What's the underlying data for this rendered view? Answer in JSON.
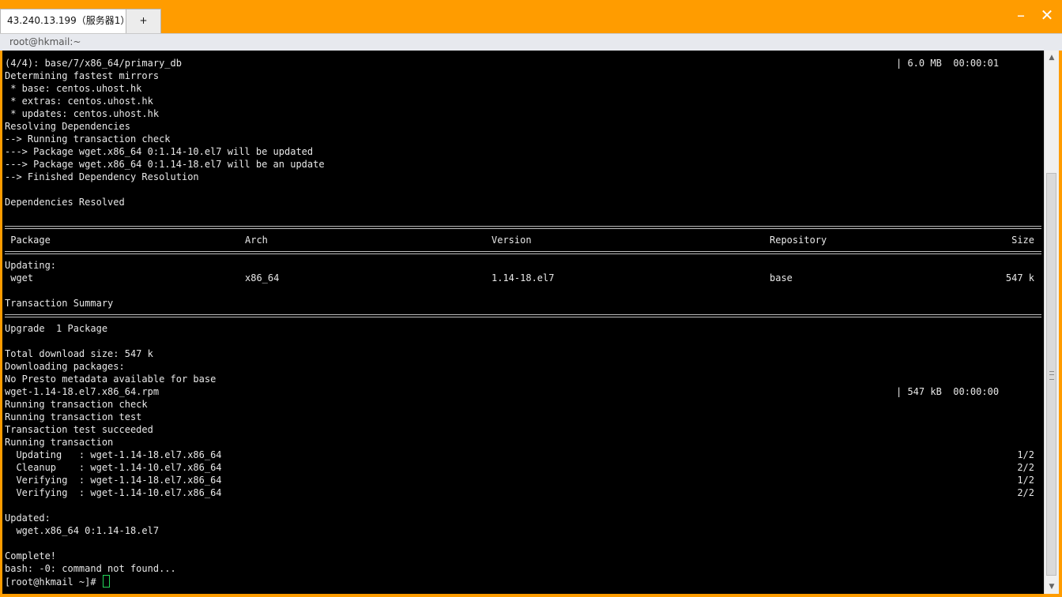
{
  "window": {
    "tabs": [
      {
        "label": "43.240.13.199（服务器1）"
      },
      {
        "label": "+"
      }
    ],
    "minimize_label": "–",
    "close_label": "✕",
    "subtitle": "root@hkmail:~"
  },
  "terminal": {
    "lines": [
      {
        "text": "(4/4): base/7/x86_64/primary_db",
        "right": "| 6.0 MB  00:00:01"
      },
      {
        "text": "Determining fastest mirrors"
      },
      {
        "text": " * base: centos.uhost.hk"
      },
      {
        "text": " * extras: centos.uhost.hk"
      },
      {
        "text": " * updates: centos.uhost.hk"
      },
      {
        "text": "Resolving Dependencies"
      },
      {
        "text": "--> Running transaction check"
      },
      {
        "text": "---> Package wget.x86_64 0:1.14-10.el7 will be updated"
      },
      {
        "text": "---> Package wget.x86_64 0:1.14-18.el7 will be an update"
      },
      {
        "text": "--> Finished Dependency Resolution"
      },
      {
        "text": ""
      },
      {
        "text": "Dependencies Resolved"
      },
      {
        "text": ""
      },
      {
        "rule": true
      },
      {
        "cols": [
          " Package",
          "Arch",
          "Version",
          "Repository",
          "Size"
        ]
      },
      {
        "rule": true
      },
      {
        "text": "Updating:"
      },
      {
        "cols": [
          " wget",
          "x86_64",
          "1.14-18.el7",
          "base",
          "547 k"
        ]
      },
      {
        "text": ""
      },
      {
        "text": "Transaction Summary"
      },
      {
        "rule": true
      },
      {
        "text": "Upgrade  1 Package"
      },
      {
        "text": ""
      },
      {
        "text": "Total download size: 547 k"
      },
      {
        "text": "Downloading packages:"
      },
      {
        "text": "No Presto metadata available for base"
      },
      {
        "text": "wget-1.14-18.el7.x86_64.rpm",
        "right": "| 547 kB  00:00:00"
      },
      {
        "text": "Running transaction check"
      },
      {
        "text": "Running transaction test"
      },
      {
        "text": "Transaction test succeeded"
      },
      {
        "text": "Running transaction"
      },
      {
        "text": "  Updating   : wget-1.14-18.el7.x86_64",
        "end": "1/2"
      },
      {
        "text": "  Cleanup    : wget-1.14-10.el7.x86_64",
        "end": "2/2"
      },
      {
        "text": "  Verifying  : wget-1.14-18.el7.x86_64",
        "end": "1/2"
      },
      {
        "text": "  Verifying  : wget-1.14-10.el7.x86_64",
        "end": "2/2"
      },
      {
        "text": ""
      },
      {
        "text": "Updated:"
      },
      {
        "text": "  wget.x86_64 0:1.14-18.el7"
      },
      {
        "text": ""
      },
      {
        "text": "Complete!"
      },
      {
        "text": "bash: -0: command not found..."
      }
    ],
    "prompt": "[root@hkmail ~]# "
  }
}
